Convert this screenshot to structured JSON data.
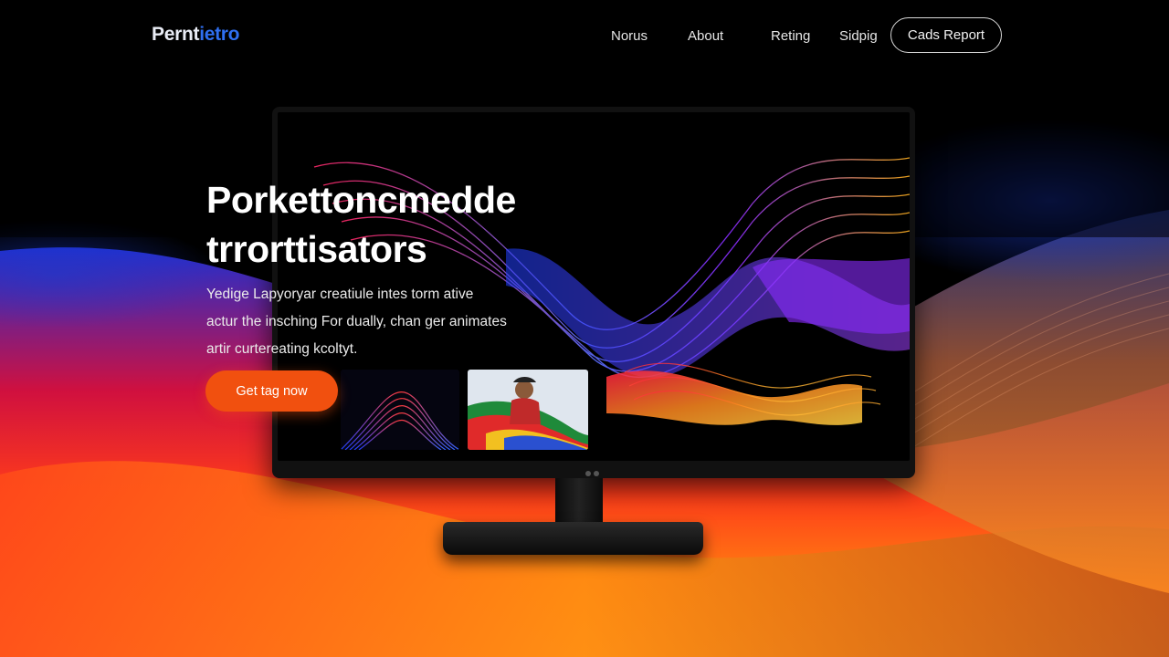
{
  "header": {
    "logo_part1": "Pernt",
    "logo_part2": "ietro",
    "nav": [
      "Norus",
      "About",
      "Reting",
      "Sidpig"
    ],
    "cta_label": "Cads Report"
  },
  "hero": {
    "title_line1": "Porkettoncmedde",
    "title_line2": "trrorttisators",
    "desc_line1": "Yedige Lapyoryar creatiule intes torm ative",
    "desc_line2": "actur the insching For dually, chan ger animates",
    "desc_line3": "artir curtereating kcoltyt.",
    "cta_label": "Get tag now"
  },
  "colors": {
    "accent_orange": "#f1500f",
    "logo_blue": "#2f6ff0"
  },
  "icons": [
    "monitor-illustration",
    "wave-background"
  ]
}
